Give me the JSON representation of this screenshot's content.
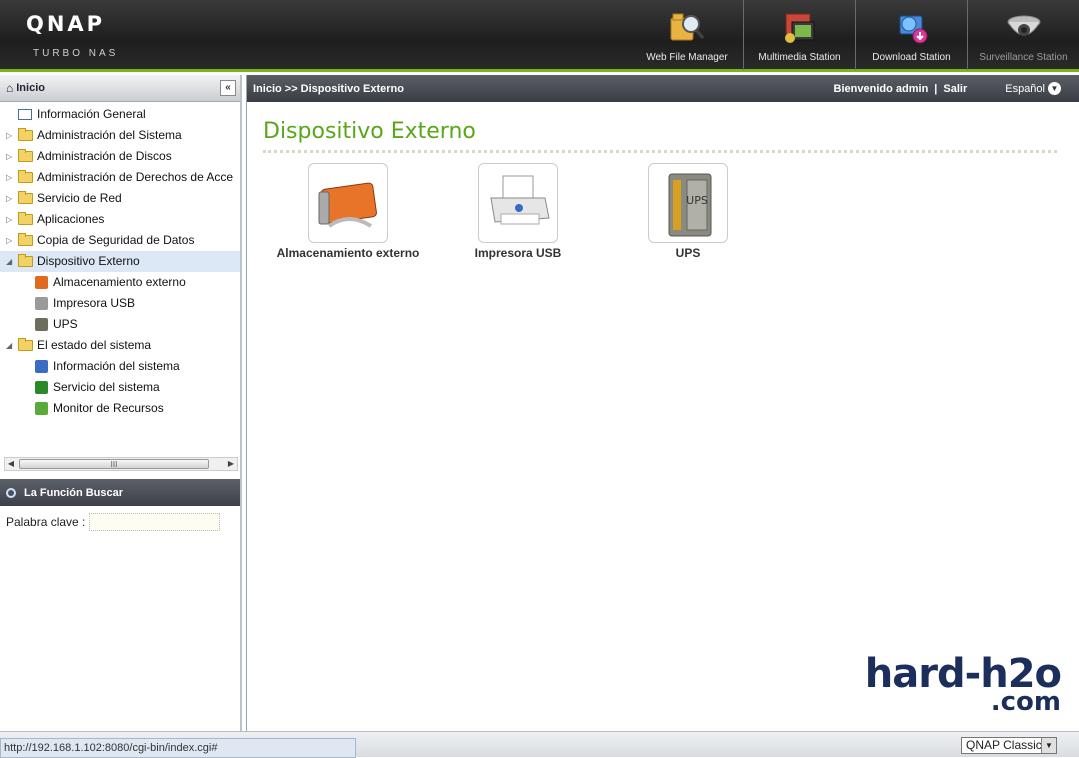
{
  "header": {
    "logo": "QNAP",
    "logo_sub": "TURBO NAS",
    "stations": [
      {
        "label": "Web File Manager",
        "icon": "folder-search-icon"
      },
      {
        "label": "Multimedia Station",
        "icon": "media-icon"
      },
      {
        "label": "Download Station",
        "icon": "download-globe-icon"
      },
      {
        "label": "Surveillance Station",
        "icon": "camera-icon"
      }
    ]
  },
  "sidebar": {
    "home_label": "Inicio",
    "tree": [
      {
        "label": "Información General",
        "type": "info"
      },
      {
        "label": "Administración del Sistema",
        "type": "folder"
      },
      {
        "label": "Administración de Discos",
        "type": "folder"
      },
      {
        "label": "Administración de Derechos de Acce",
        "type": "folder"
      },
      {
        "label": "Servicio de Red",
        "type": "folder"
      },
      {
        "label": "Aplicaciones",
        "type": "folder"
      },
      {
        "label": "Copia de Seguridad de Datos",
        "type": "folder"
      },
      {
        "label": "Dispositivo Externo",
        "type": "folder-open",
        "selected": true
      },
      {
        "label": "Almacenamiento externo",
        "type": "child",
        "color": "#e06a1e"
      },
      {
        "label": "Impresora USB",
        "type": "child",
        "color": "#9a9a9a"
      },
      {
        "label": "UPS",
        "type": "child",
        "color": "#6e6e5e"
      },
      {
        "label": "El estado del sistema",
        "type": "folder-open"
      },
      {
        "label": "Información del sistema",
        "type": "child",
        "color": "#3b6cc4"
      },
      {
        "label": "Servicio del sistema",
        "type": "child",
        "color": "#2a8a2a"
      },
      {
        "label": "Monitor de Recursos",
        "type": "child",
        "color": "#5aaa3a"
      }
    ],
    "scroll_grip": "III",
    "search": {
      "title": "La Función Buscar",
      "keyword_label": "Palabra clave :"
    }
  },
  "main": {
    "breadcrumb": "Inicio >> Dispositivo Externo",
    "welcome": "Bienvenido admin",
    "logout": "Salir",
    "language": "Español",
    "page_title": "Dispositivo Externo",
    "cards": [
      {
        "label": "Almacenamiento externo",
        "icon": "external-drive-icon"
      },
      {
        "label": "Impresora USB",
        "icon": "printer-icon"
      },
      {
        "label": "UPS",
        "icon": "ups-icon"
      }
    ],
    "watermark_top": "hard-h2o",
    "watermark_bottom": ".com"
  },
  "statusbar": {
    "url": "http://192.168.1.102:8080/cgi-bin/index.cgi#",
    "theme": "QNAP Classic"
  },
  "colors": {
    "accent_green": "#7ab51d",
    "title_green": "#5aa61a",
    "header_dark": "#2a2a2a"
  }
}
